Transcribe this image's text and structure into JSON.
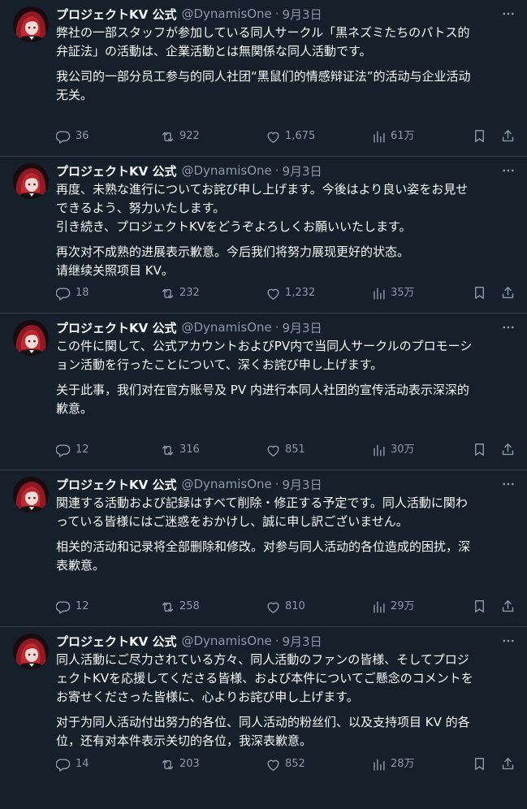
{
  "tweets": [
    {
      "name": "プロジェクトKV 公式",
      "handle": "@DynamisOne",
      "sep": "·",
      "date": "9月3日",
      "jp": "弊社の一部スタッフが参加している同人サークル「黒ネズミたちのパトス的\n弁証法」の活動は、企業活動とは無関係な同人活動です。",
      "zh": "我公司的一部分员工参与的同人社团“黑鼠们的情感辩证法”的活动与企业活动\n无关。",
      "replies": "36",
      "retweets": "922",
      "likes": "1,675",
      "views": "61万"
    },
    {
      "name": "プロジェクトKV 公式",
      "handle": "@DynamisOne",
      "sep": "·",
      "date": "9月3日",
      "jp": "再度、未熟な進行についてお詫び申し上げます。今後はより良い姿をお見せ\nできるよう、努力いたします。\n引き続き、プロジェクトKVをどうぞよろしくお願いいたします。",
      "zh": "再次对不成熟的进展表示歉意。今后我们将努力展现更好的状态。\n请继续关照项目 KV。",
      "replies": "18",
      "retweets": "232",
      "likes": "1,232",
      "views": "35万"
    },
    {
      "name": "プロジェクトKV 公式",
      "handle": "@DynamisOne",
      "sep": "·",
      "date": "9月3日",
      "jp": "この件に関して、公式アカウントおよびPV内で当同人サークルのプロモーシ\nョン活動を行ったことについて、深くお詫び申し上げます。",
      "zh": "关于此事，我们对在官方账号及 PV 内进行本同人社团的宣传活动表示深深的\n歉意。",
      "replies": "12",
      "retweets": "316",
      "likes": "851",
      "views": "30万"
    },
    {
      "name": "プロジェクトKV 公式",
      "handle": "@DynamisOne",
      "sep": "·",
      "date": "9月3日",
      "jp": "関連する活動および記録はすべて削除・修正する予定です。同人活動に関わ\nっている皆様にはご迷惑をおかけし、誠に申し訳ございません。",
      "zh": "相关的活动和记录将全部删除和修改。对参与同人活动的各位造成的困扰，深\n表歉意。",
      "replies": "12",
      "retweets": "258",
      "likes": "810",
      "views": "29万"
    },
    {
      "name": "プロジェクトKV 公式",
      "handle": "@DynamisOne",
      "sep": "·",
      "date": "9月3日",
      "jp": "同人活動にご尽力されている方々、同人活動のファンの皆様、そしてプロジ\nェクトKVを応援してくださる皆様、および本件についてご懸念のコメントを\nお寄せくださった皆様に、心よりお詫び申し上げます。",
      "zh": "对于为同人活动付出努力的各位、同人活动的粉丝们、以及支持项目 KV 的各\n位，还有对本件表示关切的各位，我深表歉意。",
      "replies": "14",
      "retweets": "203",
      "likes": "852",
      "views": "28万"
    }
  ],
  "icons": {
    "avatar": "avatar-red-hair",
    "more": "more-dots-icon",
    "reply": "reply-icon",
    "retweet": "retweet-icon",
    "like": "heart-icon",
    "views": "views-bar-icon",
    "bookmark": "bookmark-icon",
    "share": "share-icon"
  },
  "colors": {
    "background": "#15202b",
    "divider": "#38444d",
    "text": "#f7f9f9",
    "secondary": "#8b98a5"
  }
}
